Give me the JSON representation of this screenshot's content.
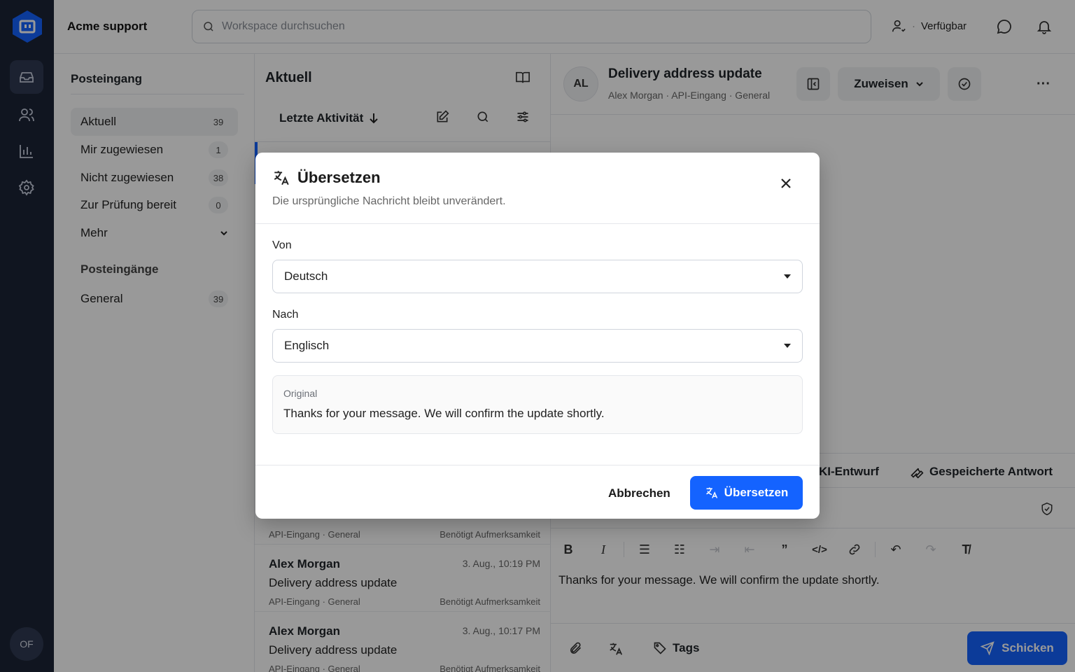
{
  "app": {
    "workspace_name": "Acme support",
    "search_placeholder": "Workspace durchsuchen",
    "status_label": "Verfügbar",
    "user_initials": "OF",
    "accent_color": "#1463ff"
  },
  "sidebar": {
    "title": "Posteingang",
    "items": [
      {
        "label": "Aktuell",
        "count": "39"
      },
      {
        "label": "Mir zugewiesen",
        "count": "1"
      },
      {
        "label": "Nicht zugewiesen",
        "count": "38"
      },
      {
        "label": "Zur Prüfung bereit",
        "count": "0"
      },
      {
        "label": "Mehr"
      }
    ],
    "group_title": "Posteingänge",
    "inboxes": [
      {
        "label": "General",
        "count": "39"
      }
    ]
  },
  "list": {
    "title": "Aktuell",
    "sort_label": "Letzte Aktivität",
    "conversations": [
      {
        "meta": "API-Eingang · General",
        "flag": "Benötigt Aufmerksamkeit"
      },
      {
        "name": "Alex Morgan",
        "time": "3. Aug., 10:19 PM",
        "subject": "Delivery address update",
        "meta": "API-Eingang · General",
        "flag": "Benötigt Aufmerksamkeit"
      },
      {
        "name": "Alex Morgan",
        "time": "3. Aug., 10:17 PM",
        "subject": "Delivery address update",
        "meta": "API-Eingang · General",
        "flag": "Benötigt Aufmerksamkeit"
      }
    ]
  },
  "detail": {
    "avatar": "AL",
    "title": "Delivery address update",
    "subtitle": "Alex Morgan · API-Eingang · General",
    "assign_label": "Zuweisen",
    "ai_draft_tab": "KI-Entwurf",
    "saved_reply_tab": "Gespeicherte Antwort",
    "body_text": "Thanks for your message. We will confirm the update shortly.",
    "tags_label": "Tags",
    "send_label": "Schicken"
  },
  "modal": {
    "title": "Übersetzen",
    "subtitle": "Die ursprüngliche Nachricht bleibt unverändert.",
    "from_label": "Von",
    "from_value": "Deutsch",
    "to_label": "Nach",
    "to_value": "Englisch",
    "original_label": "Original",
    "original_text": "Thanks for your message. We will confirm the update shortly.",
    "cancel_label": "Abbrechen",
    "confirm_label": "Übersetzen"
  }
}
